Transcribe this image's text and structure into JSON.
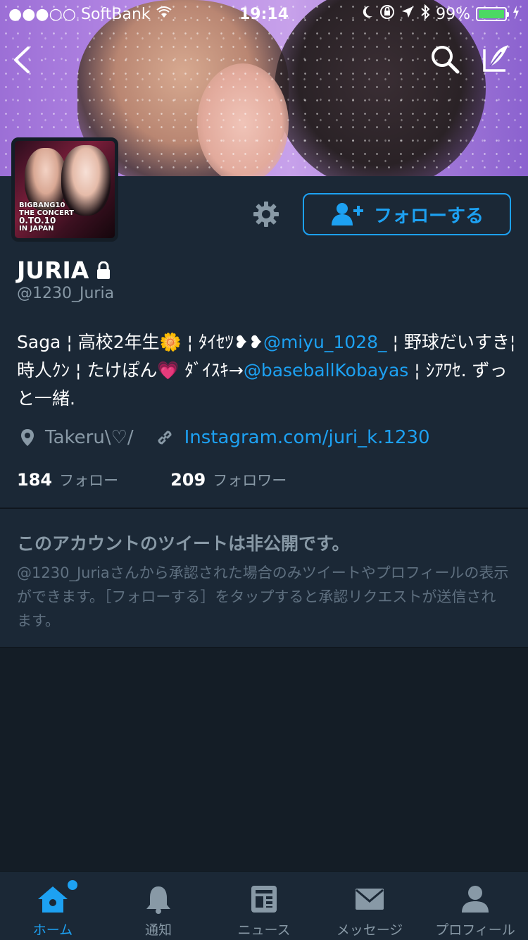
{
  "status_bar": {
    "carrier": "●●●○○ SoftBank",
    "time": "19:14",
    "battery_percent": "99%",
    "battery_level": 0.99
  },
  "nav": {
    "back_icon": "chevron-left",
    "search_icon": "magnifier",
    "compose_icon": "quill-compose"
  },
  "profile": {
    "avatar_caption_lines": [
      "BIGBANG10",
      "THE CONCERT",
      "0.TO.10",
      "IN JAPAN"
    ],
    "follow_label": "フォローする",
    "name": "JURIA",
    "handle": "@1230_Juria",
    "bio": {
      "seg1": "Saga ¦ 高校2年生🌼 ¦ ﾀｲｾﾂ❥❥",
      "mention1": "@miyu_1028_",
      "seg2": " ¦ 野球だいすき¦時人ｸﾝ ¦ たけぽん💗 ﾀﾞｲｽｷ→",
      "mention2": "@baseballKobayas",
      "seg3": " ¦ ｼｱﾜｾ. ずっと一緒."
    },
    "location": "Takeru\\♡/",
    "website": "Instagram.com/juri_k.1230",
    "following_count": "184",
    "following_label": "フォロー",
    "followers_count": "209",
    "followers_label": "フォロワー"
  },
  "protected": {
    "title": "このアカウントのツイートは非公開です。",
    "description": "@1230_Juriaさんから承認された場合のみツイートやプロフィールの表示ができます。［フォローする］をタップすると承認リクエストが送信されます。"
  },
  "tabs": [
    {
      "label": "ホーム",
      "icon": "home-icon",
      "active": true
    },
    {
      "label": "通知",
      "icon": "bell-icon",
      "active": false
    },
    {
      "label": "ニュース",
      "icon": "news-icon",
      "active": false
    },
    {
      "label": "メッセージ",
      "icon": "envelope-icon",
      "active": false
    },
    {
      "label": "プロフィール",
      "icon": "person-icon",
      "active": false
    }
  ],
  "colors": {
    "accent": "#1da1f2",
    "background": "#141d26",
    "panel": "#1b2836",
    "muted_text": "#8899a6"
  }
}
